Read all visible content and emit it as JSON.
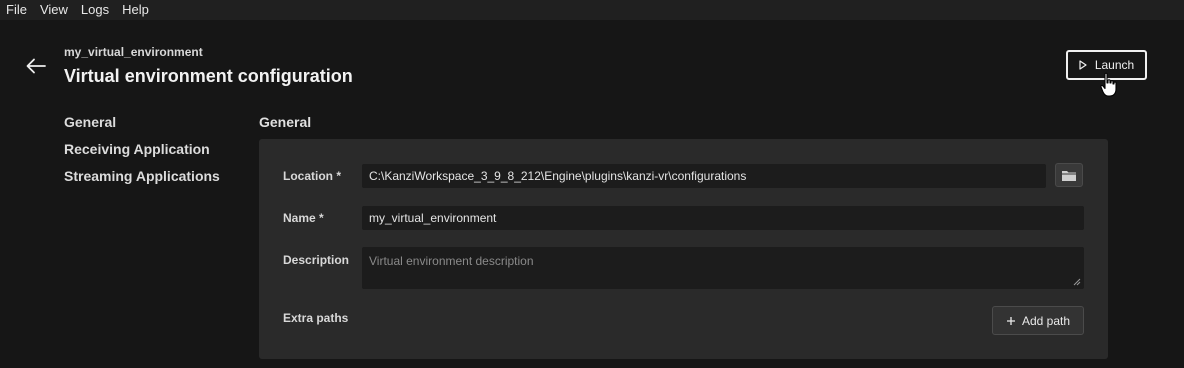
{
  "menu": [
    "File",
    "View",
    "Logs",
    "Help"
  ],
  "header": {
    "env_name": "my_virtual_environment",
    "title": "Virtual environment configuration",
    "launch_label": "Launch",
    "back_icon": "arrow-left-icon",
    "launch_icon": "play-triangle-icon"
  },
  "nav": {
    "items": [
      "General",
      "Receiving Application",
      "Streaming Applications"
    ]
  },
  "main": {
    "section_title": "General",
    "location_label": "Location *",
    "location_value": "C:\\KanziWorkspace_3_9_8_212\\Engine\\plugins\\kanzi-vr\\configurations",
    "name_label": "Name *",
    "name_value": "my_virtual_environment",
    "description_label": "Description",
    "description_placeholder": "Virtual environment description",
    "extra_paths_label": "Extra paths",
    "add_path_label": "Add path",
    "folder_icon": "folder-icon",
    "add_icon": "plus-icon"
  },
  "colors": {
    "background": "#161616",
    "panel": "#2a2a2a",
    "field": "#1c1c1c",
    "menubar": "#202020"
  }
}
